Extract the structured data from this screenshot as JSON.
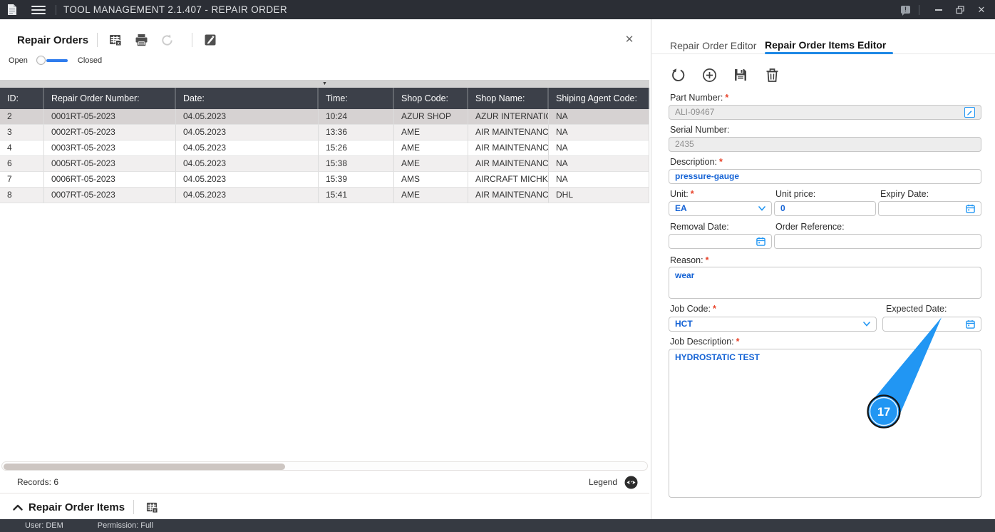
{
  "titlebar": {
    "title": "TOOL MANAGEMENT 2.1.407 - REPAIR ORDER"
  },
  "left_panel": {
    "title": "Repair Orders",
    "toggle": {
      "open_label": "Open",
      "closed_label": "Closed",
      "selected": "Open"
    },
    "table": {
      "columns": [
        "ID:",
        "Repair Order Number:",
        "Date:",
        "Time:",
        "Shop Code:",
        "Shop Name:",
        "Shiping Agent Code:"
      ],
      "rows": [
        [
          "2",
          "0001RT-05-2023",
          "04.05.2023",
          "10:24",
          "AZUR SHOP",
          "AZUR INTERNATION...",
          "NA"
        ],
        [
          "3",
          "0002RT-05-2023",
          "04.05.2023",
          "13:36",
          "AME",
          "AIR MAINTENANCE E...",
          "NA"
        ],
        [
          "4",
          "0003RT-05-2023",
          "04.05.2023",
          "15:26",
          "AME",
          "AIR MAINTENANCE E...",
          "NA"
        ],
        [
          "6",
          "0005RT-05-2023",
          "04.05.2023",
          "15:38",
          "AME",
          "AIR MAINTENANCE E...",
          "NA"
        ],
        [
          "7",
          "0006RT-05-2023",
          "04.05.2023",
          "15:39",
          "AMS",
          "AIRCRAFT MICHKAS...",
          "NA"
        ],
        [
          "8",
          "0007RT-05-2023",
          "04.05.2023",
          "15:41",
          "AME",
          "AIR MAINTENANCE E...",
          "DHL"
        ]
      ],
      "selected_row_index": 0
    },
    "records_label": "Records: 6",
    "legend_label": "Legend",
    "items_section": {
      "title": "Repair Order Items"
    }
  },
  "statusbar": {
    "user": "User: DEM",
    "permission": "Permission: Full"
  },
  "editor_panel": {
    "tabs": [
      {
        "label": "Repair Order Editor",
        "active": false
      },
      {
        "label": "Repair Order Items Editor",
        "active": true
      }
    ],
    "required_marker": "*",
    "accent_color": "#2196f3",
    "fields": {
      "part_number": {
        "label": "Part Number:",
        "required": true,
        "value": "ALI-09467"
      },
      "serial_number": {
        "label": "Serial Number:",
        "required": false,
        "value": "2435"
      },
      "description": {
        "label": "Description:",
        "required": true,
        "value": "pressure-gauge"
      },
      "unit": {
        "label": "Unit:",
        "required": true,
        "value": "EA"
      },
      "unit_price": {
        "label": "Unit price:",
        "required": false,
        "value": "0"
      },
      "expiry_date": {
        "label": "Expiry Date:",
        "required": false,
        "value": ""
      },
      "removal_date": {
        "label": "Removal Date:",
        "required": false,
        "value": ""
      },
      "order_reference": {
        "label": "Order Reference:",
        "required": false,
        "value": ""
      },
      "reason": {
        "label": "Reason:",
        "required": true,
        "value": "wear"
      },
      "job_code": {
        "label": "Job Code:",
        "required": true,
        "value": "HCT"
      },
      "expected_date": {
        "label": "Expected Date:",
        "required": false,
        "value": ""
      },
      "job_description": {
        "label": "Job Description:",
        "required": true,
        "value": "HYDROSTATIC TEST"
      }
    },
    "annotation": {
      "step_number": "17"
    }
  }
}
